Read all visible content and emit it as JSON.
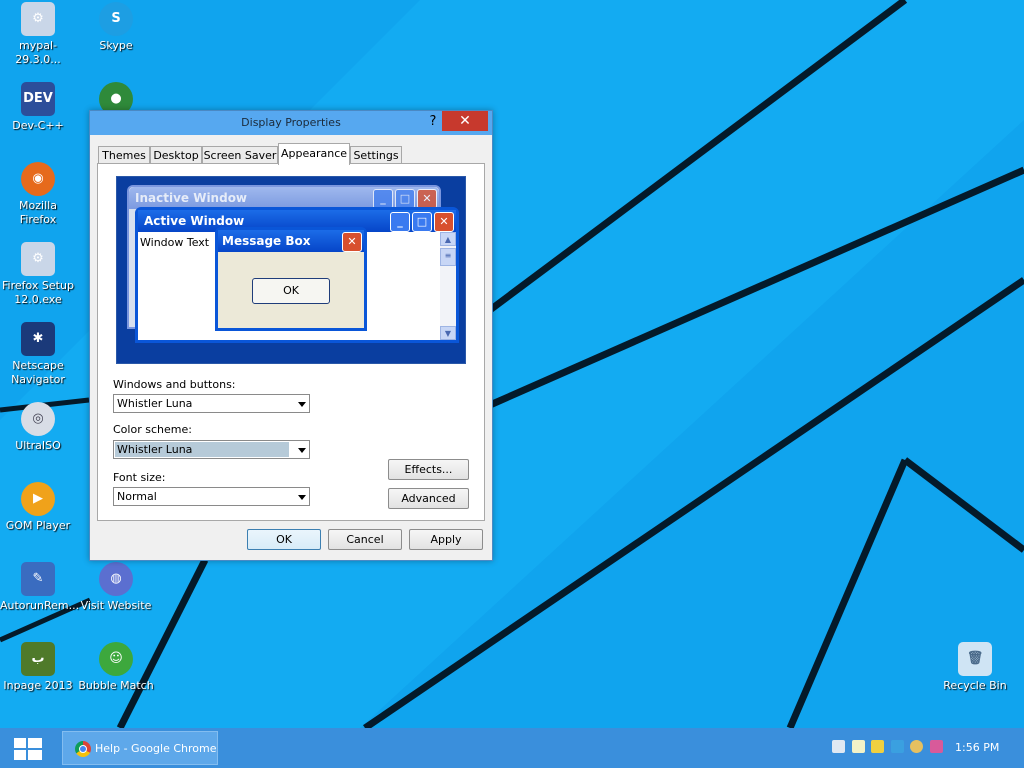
{
  "desktop": {
    "icons": [
      {
        "label": "mypal-29.3.0...",
        "icon": "installer-icon"
      },
      {
        "label": "Skype",
        "icon": "skype-icon"
      },
      {
        "label": "Dev-C++",
        "icon": "devcpp-icon"
      },
      {
        "label": "Mozilla Firefox",
        "icon": "firefox-icon"
      },
      {
        "label": "Firefox Setup 12.0.exe",
        "icon": "installer-icon"
      },
      {
        "label": "Netscape Navigator",
        "icon": "netscape-icon"
      },
      {
        "label": "UltraISO",
        "icon": "disc-icon"
      },
      {
        "label": "GOM Player",
        "icon": "gom-player-icon"
      },
      {
        "label": "AutorunRem...",
        "icon": "autorun-icon"
      },
      {
        "label": "Visit Website",
        "icon": "globe-icon"
      },
      {
        "label": "Inpage 2013",
        "icon": "inpage-icon"
      },
      {
        "label": "Bubble Match",
        "icon": "bubble-match-icon"
      },
      {
        "label": "Recycle Bin",
        "icon": "recycle-bin-icon"
      }
    ]
  },
  "dialog": {
    "title": "Display Properties",
    "help": "?",
    "close": "✕",
    "tabs": [
      "Themes",
      "Desktop",
      "Screen Saver",
      "Appearance",
      "Settings"
    ],
    "active_tab": "Appearance",
    "preview": {
      "inactive_title": "Inactive Window",
      "active_title": "Active Window",
      "window_text": "Window Text",
      "message_title": "Message Box",
      "message_ok": "OK"
    },
    "windows_buttons": {
      "label": "Windows and buttons:",
      "value": "Whistler Luna"
    },
    "color_scheme": {
      "label": "Color scheme:",
      "value": "Whistler Luna"
    },
    "font_size": {
      "label": "Font size:",
      "value": "Normal"
    },
    "effects_label": "Effects...",
    "advanced_label": "Advanced",
    "ok_label": "OK",
    "cancel_label": "Cancel",
    "apply_label": "Apply"
  },
  "taskbar": {
    "task_title": "Help - Google Chrome",
    "clock": "1:56 PM"
  },
  "colors": {
    "desktop": "#10a4ee",
    "taskbar": "#3a8fdc",
    "close": "#c7392d"
  }
}
